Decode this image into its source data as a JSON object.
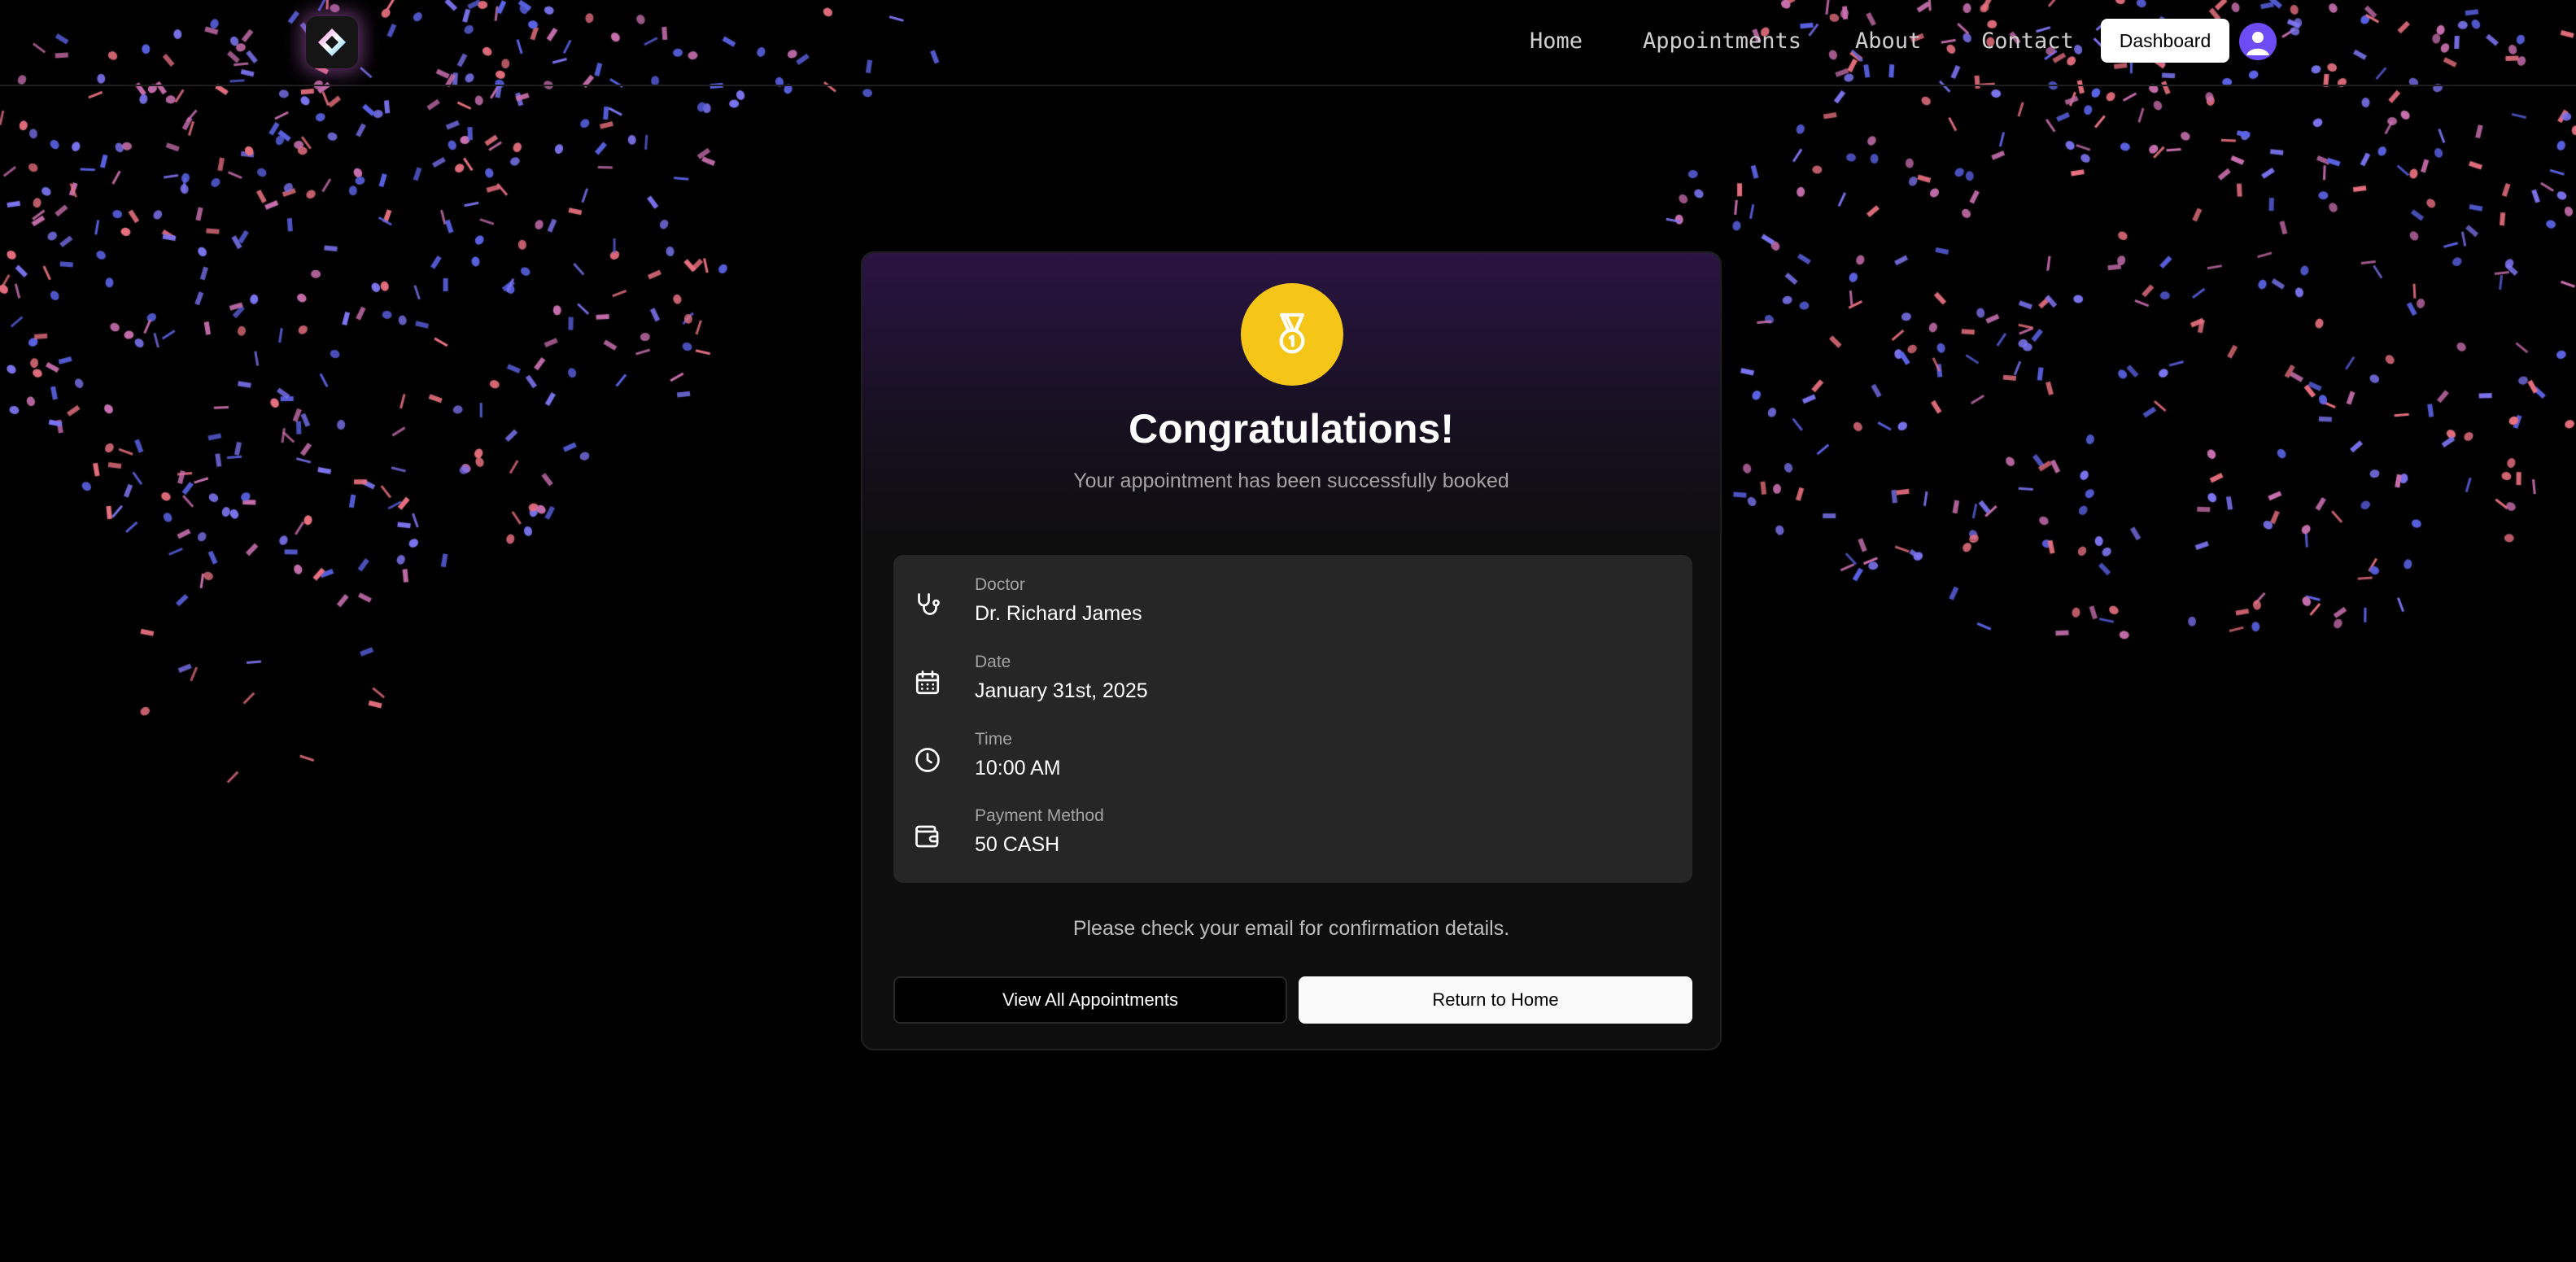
{
  "nav": {
    "links": [
      "Home",
      "Appointments",
      "About",
      "Contact"
    ],
    "dashboard_label": "Dashboard"
  },
  "icons": {
    "logo": "diamond-logo-icon",
    "avatar": "user-avatar-icon",
    "medal": "medal-icon",
    "doctor": "stethoscope-icon",
    "date": "calendar-icon",
    "time": "clock-icon",
    "payment": "wallet-icon"
  },
  "card": {
    "title": "Congratulations!",
    "subtitle": "Your appointment has been successfully booked",
    "details": [
      {
        "label": "Doctor",
        "value": "Dr. Richard James"
      },
      {
        "label": "Date",
        "value": "January 31st, 2025"
      },
      {
        "label": "Time",
        "value": "10:00 AM"
      },
      {
        "label": "Payment Method",
        "value": "50 CASH"
      }
    ],
    "note": "Please check your email for confirmation details.",
    "view_all_label": "View All Appointments",
    "return_home_label": "Return to Home"
  },
  "colors": {
    "background": "#000000",
    "accent_medal": "#f5c518",
    "avatar": "#6d4cf5",
    "card_gradient_top": "#2a1442",
    "confetti_pink": "#e8707f",
    "confetti_violet": "#7b74f0"
  }
}
